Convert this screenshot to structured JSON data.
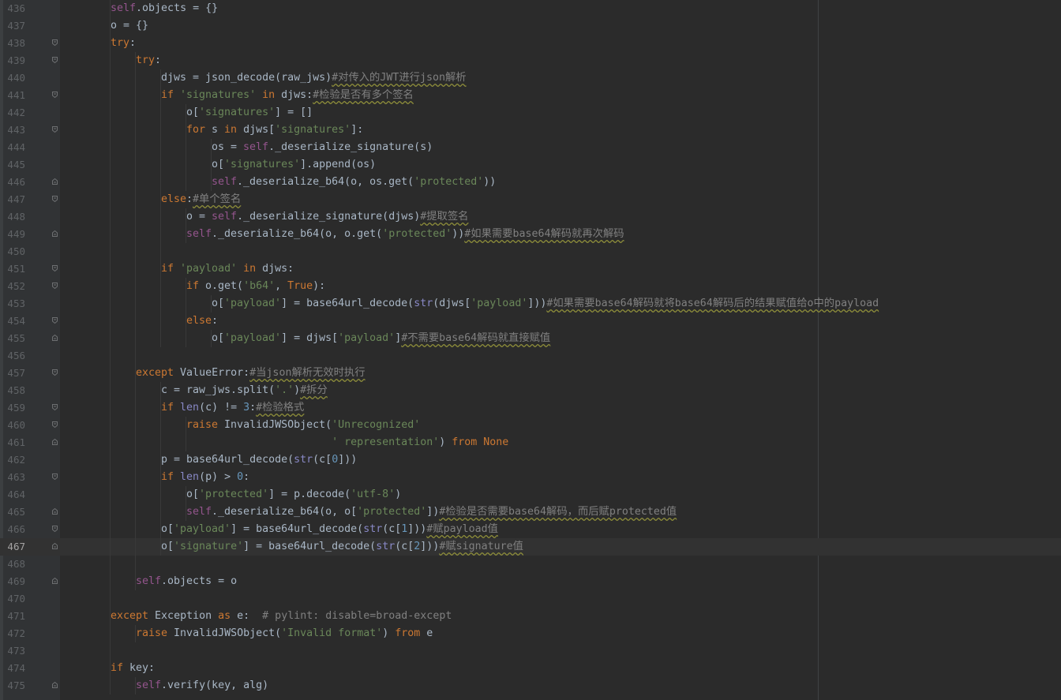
{
  "editor": {
    "current_line": 467,
    "lines": [
      {
        "n": "436",
        "i": 2,
        "f": null,
        "t": [
          [
            "self",
            "slf"
          ],
          [
            ".objects = {}",
            ""
          ]
        ]
      },
      {
        "n": "437",
        "i": 2,
        "f": null,
        "t": [
          [
            "o = {}",
            ""
          ]
        ]
      },
      {
        "n": "438",
        "i": 2,
        "f": "open",
        "t": [
          [
            "try",
            "kw"
          ],
          [
            ":",
            ""
          ]
        ]
      },
      {
        "n": "439",
        "i": 3,
        "f": "open",
        "t": [
          [
            "try",
            "kw"
          ],
          [
            ":",
            ""
          ]
        ]
      },
      {
        "n": "440",
        "i": 4,
        "f": null,
        "t": [
          [
            "djws = json_decode(raw_jws)",
            ""
          ],
          [
            "#对传入的JWT进行json解析",
            "cmt cjk"
          ]
        ]
      },
      {
        "n": "441",
        "i": 4,
        "f": "open",
        "t": [
          [
            "if ",
            "kw"
          ],
          [
            "'signatures'",
            "str"
          ],
          [
            " in ",
            "kw"
          ],
          [
            "djws:",
            ""
          ],
          [
            "#检验是否有多个签名",
            "cmt cjk"
          ]
        ]
      },
      {
        "n": "442",
        "i": 5,
        "f": null,
        "t": [
          [
            "o[",
            ""
          ],
          [
            "'signatures'",
            "str"
          ],
          [
            "] = []",
            ""
          ]
        ]
      },
      {
        "n": "443",
        "i": 5,
        "f": "open",
        "t": [
          [
            "for ",
            "kw"
          ],
          [
            "s ",
            ""
          ],
          [
            "in ",
            "kw"
          ],
          [
            "djws[",
            ""
          ],
          [
            "'signatures'",
            "str"
          ],
          [
            "]:",
            ""
          ]
        ]
      },
      {
        "n": "444",
        "i": 6,
        "f": null,
        "t": [
          [
            "os = ",
            ""
          ],
          [
            "self",
            "slf"
          ],
          [
            "._deserialize_signature(s)",
            ""
          ]
        ]
      },
      {
        "n": "445",
        "i": 6,
        "f": null,
        "t": [
          [
            "o[",
            ""
          ],
          [
            "'signatures'",
            "str"
          ],
          [
            "].append(os)",
            ""
          ]
        ]
      },
      {
        "n": "446",
        "i": 6,
        "f": "close",
        "t": [
          [
            "self",
            "slf"
          ],
          [
            "._deserialize_b64(o, os.get(",
            ""
          ],
          [
            "'protected'",
            "str"
          ],
          [
            "))",
            ""
          ]
        ]
      },
      {
        "n": "447",
        "i": 4,
        "f": "open",
        "t": [
          [
            "else",
            "kw"
          ],
          [
            ":",
            ""
          ],
          [
            "#单个签名",
            "cmt cjk"
          ]
        ]
      },
      {
        "n": "448",
        "i": 5,
        "f": null,
        "t": [
          [
            "o = ",
            ""
          ],
          [
            "self",
            "slf"
          ],
          [
            "._deserialize_signature(djws)",
            ""
          ],
          [
            "#提取签名",
            "cmt cjk"
          ]
        ]
      },
      {
        "n": "449",
        "i": 5,
        "f": "close",
        "t": [
          [
            "self",
            "slf"
          ],
          [
            "._deserialize_b64(o, o.get(",
            ""
          ],
          [
            "'protected'",
            "str"
          ],
          [
            "))",
            ""
          ],
          [
            "#如果需要base64解码就再次解码",
            "cmt cjk"
          ]
        ]
      },
      {
        "n": "450",
        "i": 4,
        "f": null,
        "t": []
      },
      {
        "n": "451",
        "i": 4,
        "f": "open",
        "t": [
          [
            "if ",
            "kw"
          ],
          [
            "'payload'",
            "str"
          ],
          [
            " in ",
            "kw"
          ],
          [
            "djws:",
            ""
          ]
        ]
      },
      {
        "n": "452",
        "i": 5,
        "f": "open",
        "t": [
          [
            "if ",
            "kw"
          ],
          [
            "o.get(",
            ""
          ],
          [
            "'b64'",
            "str"
          ],
          [
            ", ",
            ""
          ],
          [
            "True",
            "kw"
          ],
          [
            "):",
            ""
          ]
        ]
      },
      {
        "n": "453",
        "i": 6,
        "f": null,
        "t": [
          [
            "o[",
            ""
          ],
          [
            "'payload'",
            "str"
          ],
          [
            "] = base64url_decode(",
            ""
          ],
          [
            "str",
            "bi"
          ],
          [
            "(djws[",
            ""
          ],
          [
            "'payload'",
            "str"
          ],
          [
            "]))",
            ""
          ],
          [
            "#如果需要base64解码就将base64解码后的结果赋值给o中的payload",
            "cmt cjk"
          ]
        ]
      },
      {
        "n": "454",
        "i": 5,
        "f": "open",
        "t": [
          [
            "else",
            "kw"
          ],
          [
            ":",
            ""
          ]
        ]
      },
      {
        "n": "455",
        "i": 6,
        "f": "close",
        "t": [
          [
            "o[",
            ""
          ],
          [
            "'payload'",
            "str"
          ],
          [
            "] = djws[",
            ""
          ],
          [
            "'payload'",
            "str"
          ],
          [
            "]",
            ""
          ],
          [
            "#不需要base64解码就直接赋值",
            "cmt cjk"
          ]
        ]
      },
      {
        "n": "456",
        "i": 3,
        "f": null,
        "t": []
      },
      {
        "n": "457",
        "i": 3,
        "f": "open",
        "t": [
          [
            "except ",
            "kw"
          ],
          [
            "ValueError",
            ""
          ],
          [
            ":",
            ""
          ],
          [
            "#当json解析无效时执行",
            "cmt cjk"
          ]
        ]
      },
      {
        "n": "458",
        "i": 4,
        "f": null,
        "t": [
          [
            "c = raw_jws.split(",
            ""
          ],
          [
            "'.'",
            "str"
          ],
          [
            ")",
            ""
          ],
          [
            "#拆分",
            "cmt cjk"
          ]
        ]
      },
      {
        "n": "459",
        "i": 4,
        "f": "open",
        "t": [
          [
            "if ",
            "kw"
          ],
          [
            "len",
            "bi"
          ],
          [
            "(c) != ",
            ""
          ],
          [
            "3",
            "num"
          ],
          [
            ":",
            ""
          ],
          [
            "#检验格式",
            "cmt cjk"
          ]
        ]
      },
      {
        "n": "460",
        "i": 5,
        "f": "open",
        "t": [
          [
            "raise ",
            "kw"
          ],
          [
            "InvalidJWSObject(",
            ""
          ],
          [
            "'Unrecognized'",
            "str"
          ]
        ]
      },
      {
        "n": "461",
        "i": 5,
        "f": "close",
        "t": [
          [
            "                       ",
            ""
          ],
          [
            "' representation'",
            "str"
          ],
          [
            ") ",
            ""
          ],
          [
            "from ",
            "kw"
          ],
          [
            "None",
            "kw"
          ]
        ]
      },
      {
        "n": "462",
        "i": 4,
        "f": null,
        "t": [
          [
            "p = base64url_decode(",
            ""
          ],
          [
            "str",
            "bi"
          ],
          [
            "(c[",
            ""
          ],
          [
            "0",
            "num"
          ],
          [
            "]))",
            ""
          ]
        ]
      },
      {
        "n": "463",
        "i": 4,
        "f": "open",
        "t": [
          [
            "if ",
            "kw"
          ],
          [
            "len",
            "bi"
          ],
          [
            "(p) > ",
            ""
          ],
          [
            "0",
            "num"
          ],
          [
            ":",
            ""
          ]
        ]
      },
      {
        "n": "464",
        "i": 5,
        "f": null,
        "t": [
          [
            "o[",
            ""
          ],
          [
            "'protected'",
            "str"
          ],
          [
            "] = p.decode(",
            ""
          ],
          [
            "'utf-8'",
            "str"
          ],
          [
            ")",
            ""
          ]
        ]
      },
      {
        "n": "465",
        "i": 5,
        "f": "close",
        "t": [
          [
            "self",
            "slf"
          ],
          [
            "._deserialize_b64(o, o[",
            ""
          ],
          [
            "'protected'",
            "str"
          ],
          [
            "])",
            ""
          ],
          [
            "#检验是否需要base64解码，而后赋protected值",
            "cmt cjk"
          ]
        ]
      },
      {
        "n": "466",
        "i": 4,
        "f": "open",
        "t": [
          [
            "o[",
            ""
          ],
          [
            "'payload'",
            "str"
          ],
          [
            "] = base64url_decode(",
            ""
          ],
          [
            "str",
            "bi"
          ],
          [
            "(c[",
            ""
          ],
          [
            "1",
            "num"
          ],
          [
            "]))",
            ""
          ],
          [
            "#赋payload值",
            "cmt cjk"
          ]
        ]
      },
      {
        "n": "467",
        "i": 4,
        "f": "close",
        "t": [
          [
            "o[",
            ""
          ],
          [
            "'signature'",
            "str"
          ],
          [
            "] = base64url_decode(",
            ""
          ],
          [
            "str",
            "bi"
          ],
          [
            "(c[",
            ""
          ],
          [
            "2",
            "num"
          ],
          [
            "]))",
            ""
          ],
          [
            "#赋signature值",
            "cmt cjk"
          ]
        ]
      },
      {
        "n": "468",
        "i": 3,
        "f": null,
        "t": []
      },
      {
        "n": "469",
        "i": 3,
        "f": "close",
        "t": [
          [
            "self",
            "slf"
          ],
          [
            ".objects = o",
            ""
          ]
        ]
      },
      {
        "n": "470",
        "i": 2,
        "f": null,
        "t": []
      },
      {
        "n": "471",
        "i": 2,
        "f": null,
        "t": [
          [
            "except ",
            "kw"
          ],
          [
            "Exception ",
            ""
          ],
          [
            "as ",
            "kw"
          ],
          [
            "e:  ",
            ""
          ],
          [
            "# pylint: disable=broad-except",
            "cmt"
          ]
        ]
      },
      {
        "n": "472",
        "i": 3,
        "f": null,
        "t": [
          [
            "raise ",
            "kw"
          ],
          [
            "InvalidJWSObject(",
            ""
          ],
          [
            "'Invalid format'",
            "str"
          ],
          [
            ") ",
            ""
          ],
          [
            "from ",
            "kw"
          ],
          [
            "e",
            ""
          ]
        ]
      },
      {
        "n": "473",
        "i": 2,
        "f": null,
        "t": []
      },
      {
        "n": "474",
        "i": 2,
        "f": null,
        "t": [
          [
            "if ",
            "kw"
          ],
          [
            "key:",
            ""
          ]
        ]
      },
      {
        "n": "475",
        "i": 3,
        "f": "close",
        "t": [
          [
            "self",
            "slf"
          ],
          [
            ".verify(key, alg)",
            ""
          ]
        ]
      }
    ]
  },
  "colors": {
    "background": "#2b2b2b",
    "gutter": "#313335",
    "keyword": "#cc7832",
    "self": "#94558d",
    "string": "#6a8759",
    "number": "#6897bb",
    "builtin": "#8888c6",
    "comment": "#808080",
    "text": "#a9b7c6"
  },
  "icons": {
    "fold_open": "fold-open-icon",
    "fold_close": "fold-close-icon"
  }
}
